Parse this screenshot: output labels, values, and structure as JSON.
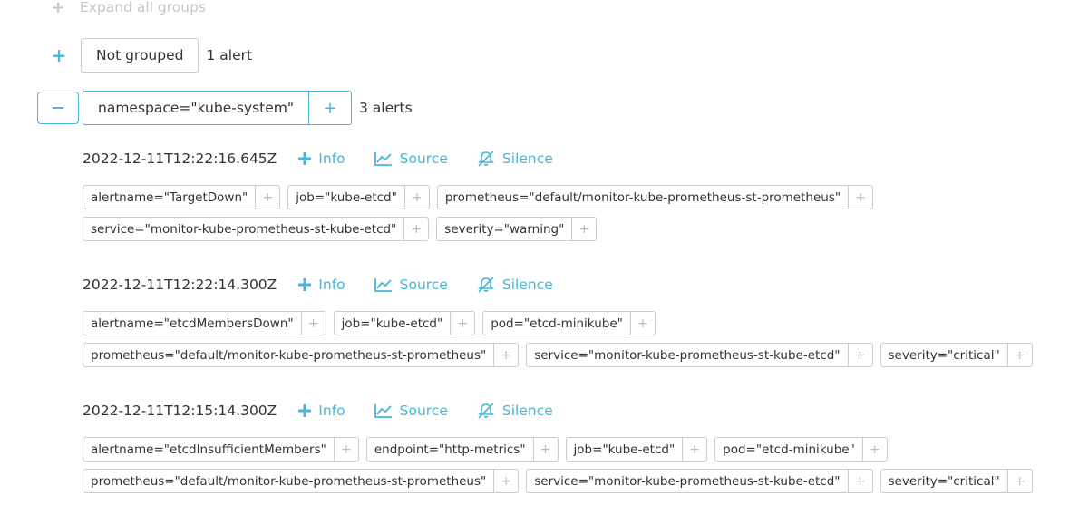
{
  "expand_all": {
    "label": "Expand all groups"
  },
  "groups": [
    {
      "label": "Not grouped",
      "count": "1 alert",
      "expanded": false
    },
    {
      "label": "namespace=\"kube-system\"",
      "count": "3 alerts",
      "expanded": true
    }
  ],
  "actions": {
    "info": "Info",
    "source": "Source",
    "silence": "Silence"
  },
  "alerts": [
    {
      "time": "2022-12-11T12:22:16.645Z",
      "rows": [
        [
          "alertname=\"TargetDown\"",
          "job=\"kube-etcd\"",
          "prometheus=\"default/monitor-kube-prometheus-st-prometheus\""
        ],
        [
          "service=\"monitor-kube-prometheus-st-kube-etcd\"",
          "severity=\"warning\""
        ]
      ]
    },
    {
      "time": "2022-12-11T12:22:14.300Z",
      "rows": [
        [
          "alertname=\"etcdMembersDown\"",
          "job=\"kube-etcd\"",
          "pod=\"etcd-minikube\""
        ],
        [
          "prometheus=\"default/monitor-kube-prometheus-st-prometheus\"",
          "service=\"monitor-kube-prometheus-st-kube-etcd\"",
          "severity=\"critical\""
        ]
      ]
    },
    {
      "time": "2022-12-11T12:15:14.300Z",
      "rows": [
        [
          "alertname=\"etcdInsufficientMembers\"",
          "endpoint=\"http-metrics\"",
          "job=\"kube-etcd\"",
          "pod=\"etcd-minikube\""
        ],
        [
          "prometheus=\"default/monitor-kube-prometheus-st-prometheus\"",
          "service=\"monitor-kube-prometheus-st-kube-etcd\"",
          "severity=\"critical\""
        ]
      ]
    }
  ],
  "colors": {
    "accent": "#4ab6d6",
    "border": "#cccccc",
    "muted": "#c7c7c7"
  }
}
